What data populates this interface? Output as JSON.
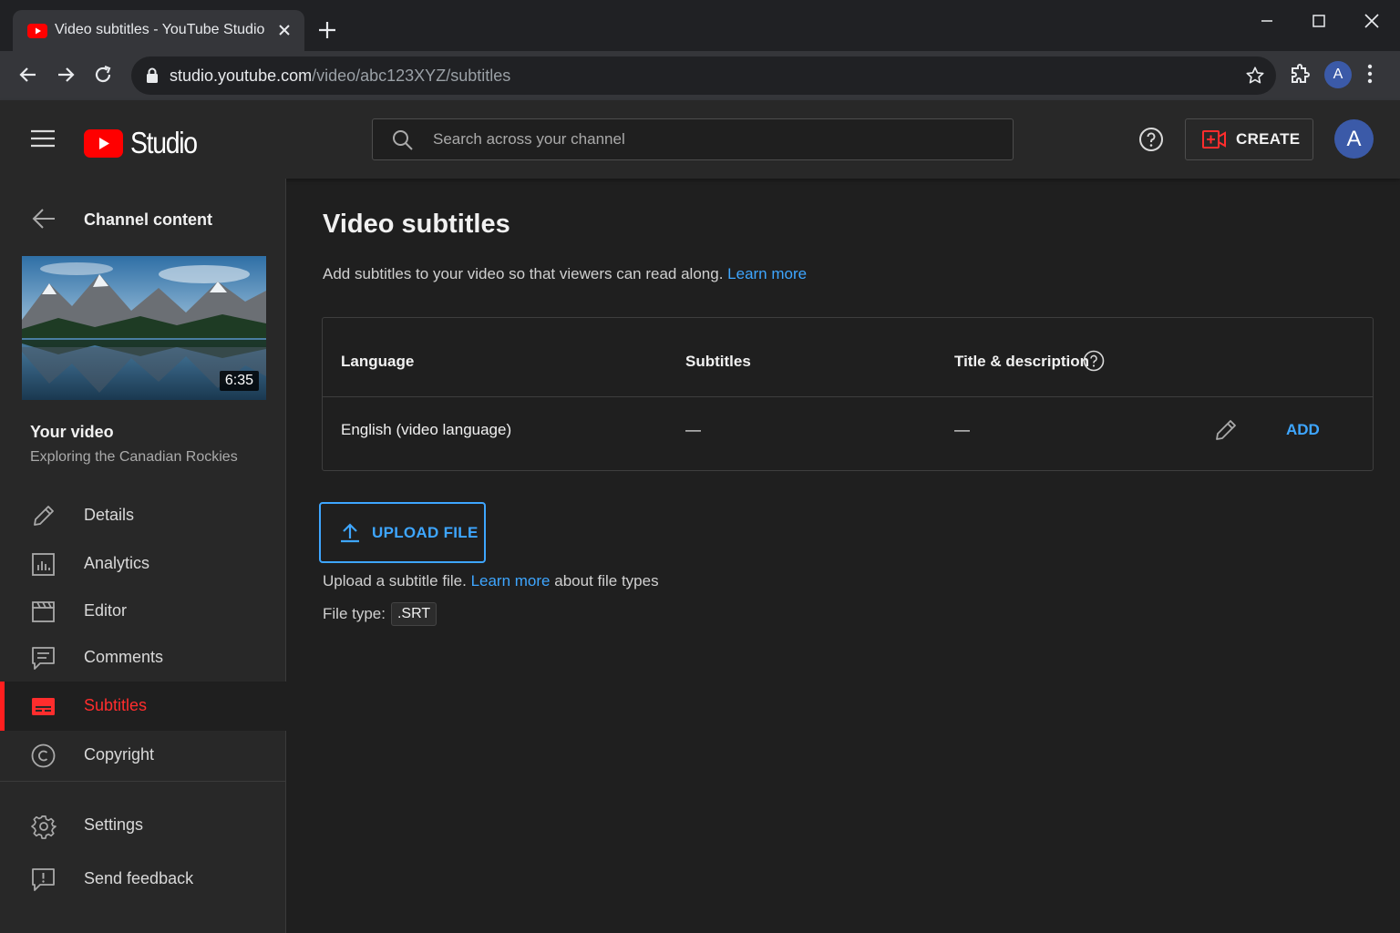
{
  "browser": {
    "tab_title": "Video subtitles - YouTube Studio",
    "url_host": "studio.youtube.com",
    "url_path": "/video/abc123XYZ/subtitles",
    "profile_initial": "A"
  },
  "header": {
    "logo_text": "Studio",
    "search_placeholder": "Search across your channel",
    "create_label": "CREATE",
    "avatar_initial": "A"
  },
  "sidebar": {
    "back_label": "Channel content",
    "video_duration": "6:35",
    "your_video_label": "Your video",
    "video_title": "Exploring the Canadian Rockies",
    "items": [
      {
        "label": "Details",
        "icon": "pencil-icon"
      },
      {
        "label": "Analytics",
        "icon": "analytics-icon"
      },
      {
        "label": "Editor",
        "icon": "clapperboard-icon"
      },
      {
        "label": "Comments",
        "icon": "comment-icon"
      },
      {
        "label": "Subtitles",
        "icon": "subtitles-icon",
        "active": true
      },
      {
        "label": "Copyright",
        "icon": "copyright-icon"
      }
    ],
    "bottom_items": [
      {
        "label": "Settings",
        "icon": "gear-icon"
      },
      {
        "label": "Send feedback",
        "icon": "feedback-icon"
      }
    ]
  },
  "main": {
    "title": "Video subtitles",
    "description": "Add subtitles to your video so that viewers can read along.",
    "learn_more": "Learn more",
    "table": {
      "headers": [
        "Language",
        "Subtitles",
        "Title & description"
      ],
      "rows": [
        {
          "language": "English (video language)",
          "subtitles": "—",
          "title_description": "—",
          "action": "ADD"
        }
      ]
    },
    "upload_label": "UPLOAD FILE",
    "upload_help_prefix": "Upload a subtitle file.",
    "upload_help_link": "Learn more",
    "upload_help_suffix": "about file types",
    "file_type_label": "File type:",
    "file_type_value": ".SRT"
  },
  "colors": {
    "accent_blue": "#3ea6ff",
    "brand_red": "#ff0000",
    "active_red": "#ff2d2d",
    "background": "#1f1f1f",
    "surface": "#282828"
  }
}
